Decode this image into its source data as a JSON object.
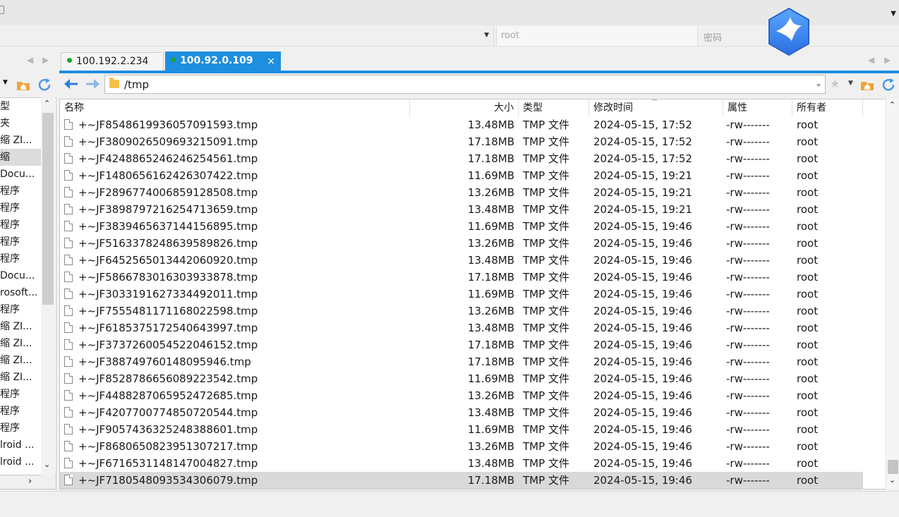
{
  "login": {
    "username_value": "root",
    "password_placeholder": "密码"
  },
  "tabs": [
    {
      "label": "100.192.2.234",
      "active": false
    },
    {
      "label": "100.92.0.109",
      "active": true
    }
  ],
  "left_panel": {
    "header": "型",
    "items": [
      "夹",
      "缩 ZI...",
      "缩",
      "Docu...",
      "程序",
      "程序",
      "程序",
      "程序",
      "程序",
      "Docu...",
      "rosoft...",
      "程序",
      "缩 ZI...",
      "缩 ZI...",
      "缩 ZI...",
      "缩 ZI...",
      "程序",
      "程序",
      "程序",
      "lroid ...",
      "lroid ..."
    ],
    "selected_index": 2
  },
  "path": {
    "current": "/tmp"
  },
  "table": {
    "columns": {
      "name": "名称",
      "size": "大小",
      "type": "类型",
      "time": "修改时间",
      "perm": "属性",
      "owner": "所有者"
    },
    "rows": [
      {
        "name": "+~JF8548619936057091593.tmp",
        "size": "13.48MB",
        "type": "TMP 文件",
        "time": "2024-05-15, 17:52",
        "perm": "-rw-------",
        "owner": "root"
      },
      {
        "name": "+~JF3809026509693215091.tmp",
        "size": "17.18MB",
        "type": "TMP 文件",
        "time": "2024-05-15, 17:52",
        "perm": "-rw-------",
        "owner": "root"
      },
      {
        "name": "+~JF4248865246246254561.tmp",
        "size": "17.18MB",
        "type": "TMP 文件",
        "time": "2024-05-15, 17:52",
        "perm": "-rw-------",
        "owner": "root"
      },
      {
        "name": "+~JF1480656162426307422.tmp",
        "size": "11.69MB",
        "type": "TMP 文件",
        "time": "2024-05-15, 19:21",
        "perm": "-rw-------",
        "owner": "root"
      },
      {
        "name": "+~JF2896774006859128508.tmp",
        "size": "13.26MB",
        "type": "TMP 文件",
        "time": "2024-05-15, 19:21",
        "perm": "-rw-------",
        "owner": "root"
      },
      {
        "name": "+~JF3898797216254713659.tmp",
        "size": "13.48MB",
        "type": "TMP 文件",
        "time": "2024-05-15, 19:21",
        "perm": "-rw-------",
        "owner": "root"
      },
      {
        "name": "+~JF3839465637144156895.tmp",
        "size": "11.69MB",
        "type": "TMP 文件",
        "time": "2024-05-15, 19:46",
        "perm": "-rw-------",
        "owner": "root"
      },
      {
        "name": "+~JF5163378248639589826.tmp",
        "size": "13.26MB",
        "type": "TMP 文件",
        "time": "2024-05-15, 19:46",
        "perm": "-rw-------",
        "owner": "root"
      },
      {
        "name": "+~JF6452565013442060920.tmp",
        "size": "13.48MB",
        "type": "TMP 文件",
        "time": "2024-05-15, 19:46",
        "perm": "-rw-------",
        "owner": "root"
      },
      {
        "name": "+~JF5866783016303933878.tmp",
        "size": "17.18MB",
        "type": "TMP 文件",
        "time": "2024-05-15, 19:46",
        "perm": "-rw-------",
        "owner": "root"
      },
      {
        "name": "+~JF3033191627334492011.tmp",
        "size": "11.69MB",
        "type": "TMP 文件",
        "time": "2024-05-15, 19:46",
        "perm": "-rw-------",
        "owner": "root"
      },
      {
        "name": "+~JF7555481171168022598.tmp",
        "size": "13.26MB",
        "type": "TMP 文件",
        "time": "2024-05-15, 19:46",
        "perm": "-rw-------",
        "owner": "root"
      },
      {
        "name": "+~JF6185375172540643997.tmp",
        "size": "13.48MB",
        "type": "TMP 文件",
        "time": "2024-05-15, 19:46",
        "perm": "-rw-------",
        "owner": "root"
      },
      {
        "name": "+~JF3737260054522046152.tmp",
        "size": "17.18MB",
        "type": "TMP 文件",
        "time": "2024-05-15, 19:46",
        "perm": "-rw-------",
        "owner": "root"
      },
      {
        "name": "+~JF388749760148095946.tmp",
        "size": "17.18MB",
        "type": "TMP 文件",
        "time": "2024-05-15, 19:46",
        "perm": "-rw-------",
        "owner": "root"
      },
      {
        "name": "+~JF8528786656089223542.tmp",
        "size": "11.69MB",
        "type": "TMP 文件",
        "time": "2024-05-15, 19:46",
        "perm": "-rw-------",
        "owner": "root"
      },
      {
        "name": "+~JF4488287065952472685.tmp",
        "size": "13.26MB",
        "type": "TMP 文件",
        "time": "2024-05-15, 19:46",
        "perm": "-rw-------",
        "owner": "root"
      },
      {
        "name": "+~JF4207700774850720544.tmp",
        "size": "13.48MB",
        "type": "TMP 文件",
        "time": "2024-05-15, 19:46",
        "perm": "-rw-------",
        "owner": "root"
      },
      {
        "name": "+~JF9057436325248388601.tmp",
        "size": "11.69MB",
        "type": "TMP 文件",
        "time": "2024-05-15, 19:46",
        "perm": "-rw-------",
        "owner": "root"
      },
      {
        "name": "+~JF8680650823951307217.tmp",
        "size": "13.26MB",
        "type": "TMP 文件",
        "time": "2024-05-15, 19:46",
        "perm": "-rw-------",
        "owner": "root"
      },
      {
        "name": "+~JF6716531148147004827.tmp",
        "size": "13.48MB",
        "type": "TMP 文件",
        "time": "2024-05-15, 19:46",
        "perm": "-rw-------",
        "owner": "root"
      },
      {
        "name": "+~JF7180548093534306079.tmp",
        "size": "17.18MB",
        "type": "TMP 文件",
        "time": "2024-05-15, 19:46",
        "perm": "-rw-------",
        "owner": "root"
      }
    ],
    "selected_index": 21,
    "sort_column": "time"
  },
  "icons": {
    "back": "back-arrow-icon",
    "forward": "forward-arrow-icon",
    "home": "home-folder-icon",
    "refresh": "refresh-icon",
    "bookmark": "star-icon",
    "folder": "folder-icon",
    "file": "file-icon",
    "logo": "bird-logo-icon"
  },
  "colors": {
    "accent": "#1e8ee0",
    "online_dot": "#1fa52b",
    "selection": "#d9d9d9"
  }
}
